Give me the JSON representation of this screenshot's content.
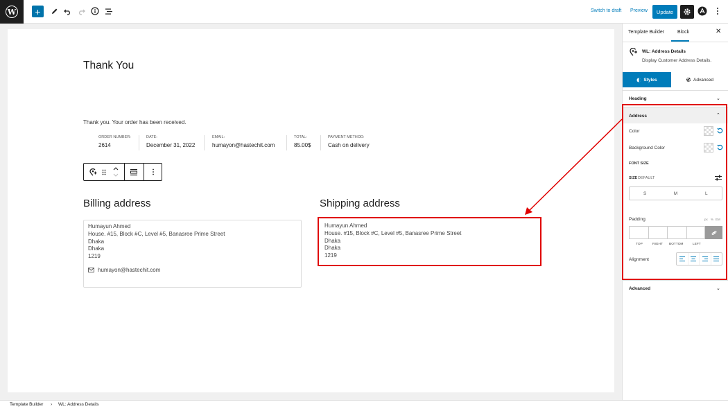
{
  "topbar": {
    "switch_to_draft": "Switch to draft",
    "preview": "Preview",
    "update": "Update"
  },
  "page": {
    "title": "Thank You",
    "received_text": "Thank you. Your order has been received.",
    "order_details": [
      {
        "label": "ORDER NUMBER:",
        "value": "2614"
      },
      {
        "label": "DATE:",
        "value": "December 31, 2022"
      },
      {
        "label": "EMAIL:",
        "value": "humayon@hastechit.com"
      },
      {
        "label": "TOTAL:",
        "value": "85.00$"
      },
      {
        "label": "PAYMENT METHOD:",
        "value": "Cash on delivery"
      }
    ],
    "billing": {
      "heading": "Billing address",
      "lines": [
        "Humayun Ahmed",
        "House. #15, Block #C, Level #5, Banasree Prime Street",
        "Dhaka",
        "Dhaka",
        "1219"
      ],
      "email": "humayon@hastechit.com"
    },
    "shipping": {
      "heading": "Shipping address",
      "lines": [
        "Humayun Ahmed",
        "House. #15, Block #C, Level #5, Banasree Prime Street",
        "Dhaka",
        "Dhaka",
        "1219"
      ]
    }
  },
  "sidebar": {
    "tabs": [
      "Template Builder",
      "Block"
    ],
    "active_tab": "Block",
    "block_name": "WL: Address Details",
    "block_desc": "Display Customer Address Details.",
    "style_tabs": {
      "styles": "Styles",
      "advanced": "Advanced"
    },
    "heading_section": "Heading",
    "address_section": "Address",
    "color_label": "Color",
    "bg_color_label": "Background Color",
    "font_size_label": "FONT SIZE",
    "size_label": "SIZE",
    "size_default": "DEFAULT",
    "sizes": [
      "S",
      "M",
      "L"
    ],
    "padding_label": "Padding",
    "padding_units": [
      "px",
      "%",
      "EM"
    ],
    "padding_sides": [
      "TOP",
      "RIGHT",
      "BOTTOM",
      "LEFT"
    ],
    "alignment_label": "Alignment",
    "advanced_section": "Advanced"
  },
  "footer": {
    "breadcrumb": [
      "Template Builder",
      "WL: Address Details"
    ]
  },
  "colors": {
    "accent": "#007cba",
    "highlight": "#e00000"
  }
}
